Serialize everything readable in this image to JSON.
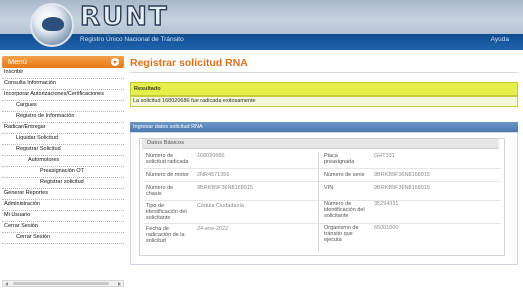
{
  "header": {
    "logo_text": "RUNT",
    "subtitle": "Registro Único Nacional de Tránsito",
    "help": "Ayuda"
  },
  "sidebar": {
    "menu_title": "Menú",
    "items": [
      {
        "label": "Inscribir"
      },
      {
        "label": "Consulta Información"
      },
      {
        "label": "Incorporar Autorizaciones/Certificaciones"
      },
      {
        "label": "Cargues"
      },
      {
        "label": "Registro de Información"
      },
      {
        "label": "Radicar/Entregar"
      },
      {
        "label": "Liquidar Solicitud"
      },
      {
        "label": "Registrar Solicitud"
      },
      {
        "label": "Automotores"
      },
      {
        "label": "Preasignación OT"
      },
      {
        "label": "Registrar solicitud"
      },
      {
        "label": "Generar Reportes"
      },
      {
        "label": "Administración"
      },
      {
        "label": "Mi Usuario"
      },
      {
        "label": "Cerrar Sesión"
      },
      {
        "label": "Cerrar Sesión"
      }
    ]
  },
  "main": {
    "title": "Registrar solicitud RNA",
    "result": {
      "label": "Resultado",
      "message": "La solicitud 168020686 fue radicada exitosamente"
    },
    "section_title": "Ingresar datos solicitud RNA",
    "basic_data": {
      "legend": "Datos Básicos",
      "fields": {
        "numero_solicitud": {
          "label": "Número de solicitud radicada",
          "value": "168020686"
        },
        "placa": {
          "label": "Placa preasignada",
          "value": "GHT331"
        },
        "numero_motor": {
          "label": "Número de motor",
          "value": "2NR4571356"
        },
        "numero_serie": {
          "label": "Número de serie",
          "value": "9BRKB9F36N8168915"
        },
        "numero_chasis": {
          "label": "Número de chasis",
          "value": "9BRKB9F36N8168915"
        },
        "vin": {
          "label": "VIN",
          "value": "9BRKB9F36N8168915"
        },
        "tipo_identificacion": {
          "label": "Tipo de identificación del solicitante",
          "value": "Cédula Ciudadanía"
        },
        "numero_identificacion": {
          "label": "Número de identificación del solicitante",
          "value": "35294331"
        },
        "fecha_radicacion": {
          "label": "Fecha de radicación de la solicitud",
          "value": "24-ene-2022"
        },
        "organismo_transito": {
          "label": "Organismo de tránsito que ejecuta",
          "value": "65001000"
        }
      }
    }
  },
  "colors": {
    "accent_orange": "#e0701a",
    "result_yellow": "#e5ef4a",
    "panel_blue": "#4c79b1",
    "banner_blue": "#1f63ad"
  }
}
